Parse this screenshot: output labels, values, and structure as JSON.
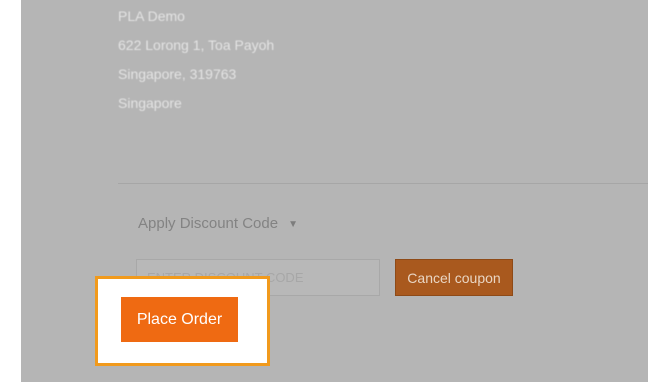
{
  "shipping_address": {
    "lines": [
      "PLA Demo",
      "622 Lorong 1, Toa Payoh",
      "Singapore, 319763",
      "Singapore"
    ]
  },
  "discount": {
    "toggle_label": "Apply Discount Code",
    "toggle_icon": "chevron-down-icon",
    "input_placeholder": "ENTER DISCOUNT CODE",
    "cancel_label": "Cancel coupon"
  },
  "order": {
    "place_order_label": "Place Order"
  },
  "colors": {
    "overlay_gray": "#b5b5b5",
    "highlight_border": "#f19a1c",
    "primary_button": "#ef6a12",
    "dimmed_button": "#a9591e"
  }
}
